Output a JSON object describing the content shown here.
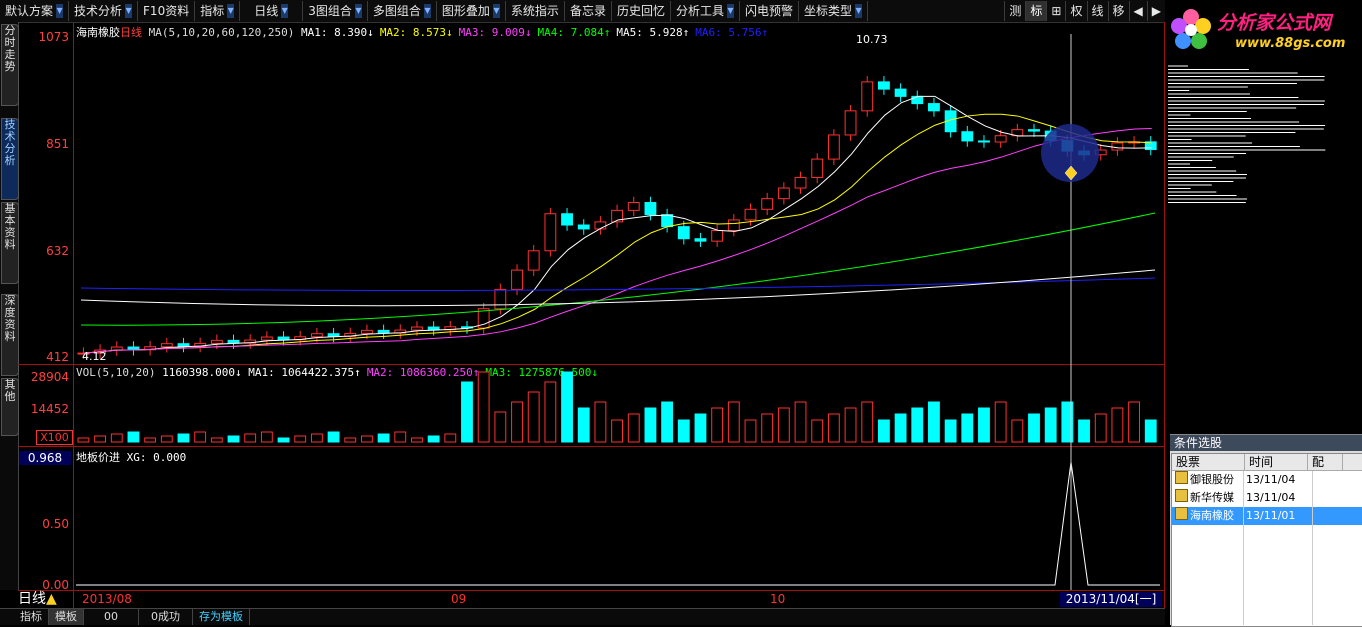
{
  "toolbar": {
    "items": [
      "默认方案",
      "技术分析",
      "F10资料",
      "指标",
      "日线",
      "3图组合",
      "多图组合",
      "图形叠加",
      "系统指示",
      "备忘录",
      "历史回忆",
      "分析工具",
      "闪电预警",
      "坐标类型"
    ],
    "right_buttons": [
      "测",
      "标",
      "⊞",
      "权",
      "线",
      "移",
      "◀",
      "▶"
    ],
    "active_right": "标"
  },
  "sidebar": {
    "tabs": [
      "分时走势",
      "技术分析",
      "基本资料",
      "深度资料",
      "其他"
    ],
    "active": "技术分析"
  },
  "logo": {
    "title": "分析家公式网",
    "url": "www.88gs.com"
  },
  "main_chart": {
    "stock_name": "海南橡胶",
    "period": "日线",
    "ma_params": "MA(5,10,20,60,120,250)",
    "ma_values": [
      {
        "label": "MA1:",
        "value": "8.390↓",
        "color": "#ffffff"
      },
      {
        "label": "MA2:",
        "value": "8.573↓",
        "color": "#ffff00"
      },
      {
        "label": "MA3:",
        "value": "9.009↓",
        "color": "#ff40ff"
      },
      {
        "label": "MA4:",
        "value": "7.084↑",
        "color": "#00ff00"
      },
      {
        "label": "MA5:",
        "value": "5.928↑",
        "color": "#ffffff"
      },
      {
        "label": "MA6:",
        "value": "5.756↑",
        "color": "#2020ff"
      }
    ],
    "y_ticks": [
      "1073",
      "851",
      "632",
      "412"
    ],
    "high_label": "10.73",
    "low_label": "4.12"
  },
  "volume_chart": {
    "info": "VOL(5,10,20)",
    "vol_value": "1160398.000↓",
    "ma_values": [
      {
        "label": "MA1:",
        "value": "1064422.375↑",
        "color": "#ffffff"
      },
      {
        "label": "MA2:",
        "value": "1086360.250↑",
        "color": "#ff40ff"
      },
      {
        "label": "MA3:",
        "value": "1275876.500↓",
        "color": "#00ff00"
      }
    ],
    "y_ticks": [
      "28904",
      "14452"
    ],
    "unit": "X100"
  },
  "indicator_chart": {
    "name": "地板价进",
    "value_label": "XG: 0.000",
    "y_ticks": [
      "0.968",
      "0.50",
      "0.00"
    ]
  },
  "x_axis": {
    "dates": [
      "2013/08",
      "09",
      "10"
    ],
    "current_date": "2013/11/04[一]"
  },
  "period_label": "日线",
  "condition_panel": {
    "title": "条件选股",
    "columns": [
      "股票",
      "时间",
      "配"
    ],
    "rows": [
      {
        "name": "御银股份",
        "date": "13/11/04",
        "selected": false
      },
      {
        "name": "新华传媒",
        "date": "13/11/04",
        "selected": false
      },
      {
        "name": "海南橡胶",
        "date": "13/11/01",
        "selected": true
      }
    ]
  },
  "bottom_tabs": [
    "指标",
    "模板",
    "00",
    "0成功",
    "存为模板"
  ],
  "colors": {
    "up": "#ff3030",
    "down": "#00ffff",
    "axis": "#a01010",
    "ma1": "#ffffff",
    "ma2": "#ffff00",
    "ma3": "#ff40ff",
    "ma4": "#00ff00",
    "ma6": "#2020ff"
  }
}
